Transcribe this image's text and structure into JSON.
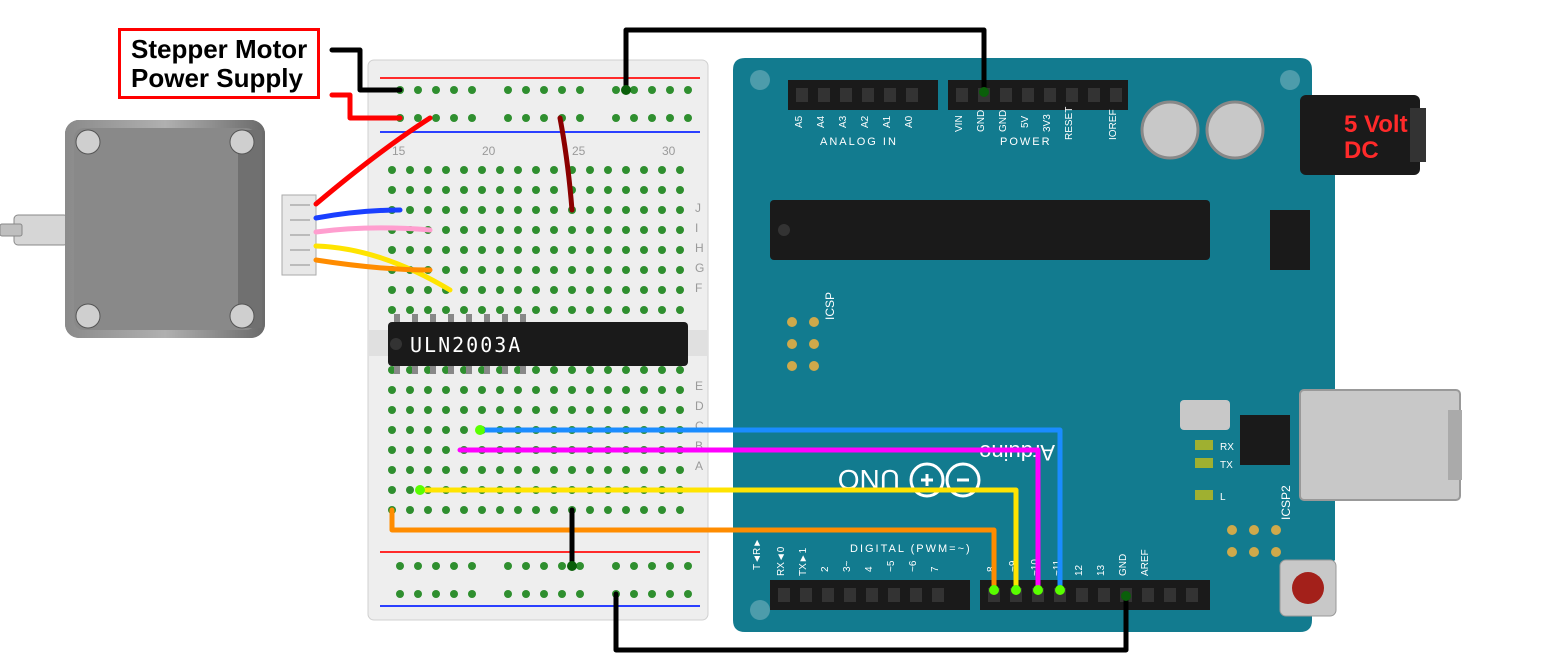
{
  "labels": {
    "power_supply_line1": "Stepper Motor",
    "power_supply_line2": "Power Supply",
    "voltage_line1": "5 Volt",
    "voltage_line2": "DC"
  },
  "chip": {
    "name": "ULN2003A"
  },
  "arduino": {
    "brand": "Arduino",
    "model": "UNO",
    "reset_label": "RESET",
    "icsp_label": "ICSP",
    "icsp2_label": "ICSP2",
    "tx_label": "TX",
    "rx_label": "RX",
    "l_label": "L",
    "digital_section": "DIGITAL  (PWM=~)",
    "analog_section": "ANALOG IN",
    "power_section": "POWER",
    "analog_pins": [
      "A5",
      "A4",
      "A3",
      "A2",
      "A1",
      "A0"
    ],
    "power_pins": [
      "VIN",
      "GND",
      "GND",
      "5V",
      "3V3",
      "RESET",
      "IOREF"
    ],
    "digital_pins": [
      "RX◄0",
      "TX►1",
      "2",
      "3~",
      "4",
      "~5",
      "~6",
      "7",
      "8",
      "~9",
      "~10",
      "~11",
      "12",
      "13",
      "GND",
      "AREF"
    ],
    "rx_arrow": "R►",
    "tx_arrow": "T◄"
  },
  "breadboard": {
    "col_numbers": [
      "15",
      "20",
      "25",
      "30"
    ],
    "row_letters_top": [
      "J",
      "I",
      "H",
      "G",
      "F"
    ],
    "row_letters_bottom": [
      "E",
      "D",
      "C",
      "B",
      "A"
    ]
  },
  "wires": [
    {
      "name": "gnd-top-black",
      "color": "#000",
      "from": "breadboard-top-rail",
      "to": "arduino-gnd-top"
    },
    {
      "name": "stepper-power-black",
      "color": "#000",
      "from": "label",
      "to": "breadboard-top-rail-neg"
    },
    {
      "name": "stepper-power-red",
      "color": "#ff0000",
      "from": "label",
      "to": "breadboard-top-rail-pos"
    },
    {
      "name": "vin-darkred",
      "color": "#8b0000",
      "from": "breadboard-top-rail-pos",
      "to": "uln-com"
    },
    {
      "name": "motor-red",
      "color": "#ff0000",
      "from": "stepper",
      "to": "breadboard"
    },
    {
      "name": "motor-blue",
      "color": "#1a3fff",
      "from": "stepper",
      "to": "breadboard"
    },
    {
      "name": "motor-pink",
      "color": "#ff9ecf",
      "from": "stepper",
      "to": "breadboard"
    },
    {
      "name": "motor-yellow",
      "color": "#ffe400",
      "from": "stepper",
      "to": "breadboard"
    },
    {
      "name": "motor-orange",
      "color": "#ff8c00",
      "from": "stepper",
      "to": "breadboard"
    },
    {
      "name": "uln-blue",
      "color": "#1a8cff",
      "from": "uln-out",
      "to": "arduino-D11"
    },
    {
      "name": "uln-magenta",
      "color": "#ff00ff",
      "from": "uln-out",
      "to": "arduino-D10"
    },
    {
      "name": "uln-yellow",
      "color": "#ffe400",
      "from": "uln-out",
      "to": "arduino-D9"
    },
    {
      "name": "uln-orange",
      "color": "#ff8c00",
      "from": "uln-out",
      "to": "arduino-D8"
    },
    {
      "name": "uln-gnd-black-top",
      "color": "#000",
      "from": "uln-gnd",
      "to": "breadboard-bottom-rail"
    },
    {
      "name": "bottom-gnd-black",
      "color": "#000",
      "from": "breadboard-bottom-rail",
      "to": "arduino-gnd-digital"
    }
  ],
  "components": [
    "stepper-motor",
    "breadboard",
    "uln2003a-ic",
    "arduino-uno",
    "dc-jack",
    "usb-port",
    "reset-button"
  ]
}
